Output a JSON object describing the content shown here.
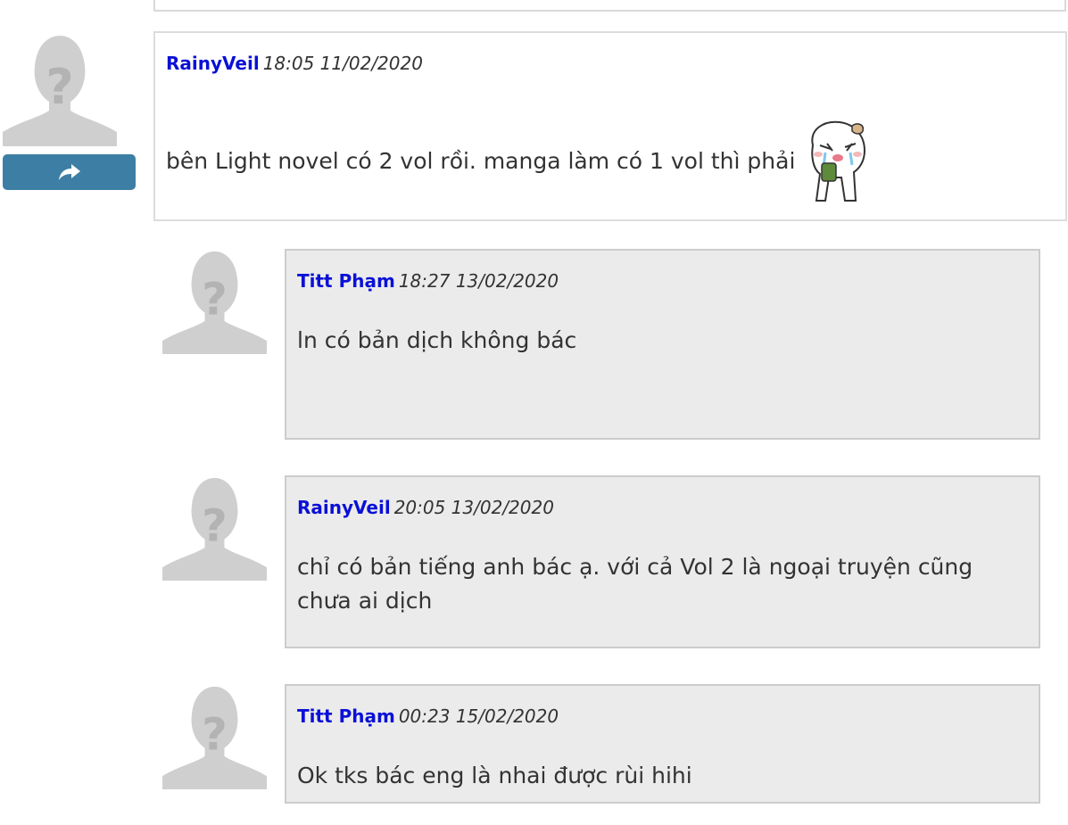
{
  "thread": {
    "root": {
      "author": "RainyVeil",
      "time": "18:05 11/02/2020",
      "text": "bên Light novel có 2 vol rồi. manga làm có 1 vol thì phải",
      "emoticon": "crying-bun-emoticon",
      "share_icon": "share-arrow-icon"
    },
    "replies": [
      {
        "author": "Titt Phạm",
        "time": "18:27 13/02/2020",
        "text": "ln có bản dịch không bác"
      },
      {
        "author": "RainyVeil",
        "time": "20:05 13/02/2020",
        "text": "chỉ có bản tiếng anh bác ạ. với cả Vol 2 là ngoại truyện cũng chưa ai dịch"
      },
      {
        "author": "Titt Phạm",
        "time": "00:23 15/02/2020",
        "text": "Ok tks bác eng là nhai được rùi hihi"
      }
    ]
  },
  "colors": {
    "author_link": "#0a10d6",
    "share_button": "#3d7ea4",
    "reply_bg": "#ebebeb"
  },
  "icons": {
    "avatar": "default-avatar-icon"
  }
}
